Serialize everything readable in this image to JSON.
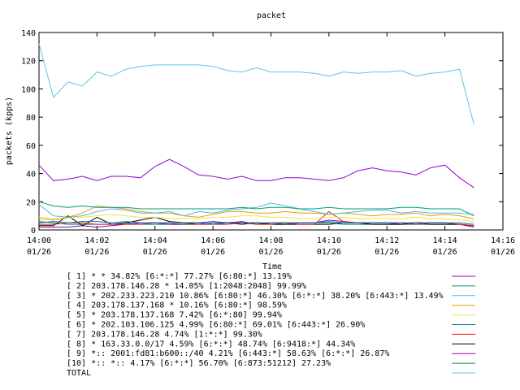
{
  "chart_data": {
    "type": "line",
    "title": "packet",
    "xlabel": "Time",
    "ylabel": "packets (kpps)",
    "ylim": [
      0,
      140
    ],
    "yticks": [
      0,
      20,
      40,
      60,
      80,
      100,
      120,
      140
    ],
    "xlim": [
      "14:00",
      "14:16"
    ],
    "xticks": [
      {
        "time": "14:00",
        "date": "01/26"
      },
      {
        "time": "14:02",
        "date": "01/26"
      },
      {
        "time": "14:04",
        "date": "01/26"
      },
      {
        "time": "14:06",
        "date": "01/26"
      },
      {
        "time": "14:08",
        "date": "01/26"
      },
      {
        "time": "14:10",
        "date": "01/26"
      },
      {
        "time": "14:12",
        "date": "01/26"
      },
      {
        "time": "14:14",
        "date": "01/26"
      },
      {
        "time": "14:16",
        "date": "01/26"
      }
    ],
    "x": [
      "14:00",
      "14:00:30",
      "14:01",
      "14:01:30",
      "14:02",
      "14:02:30",
      "14:03",
      "14:03:30",
      "14:04",
      "14:04:30",
      "14:05",
      "14:05:30",
      "14:06",
      "14:06:30",
      "14:07",
      "14:07:30",
      "14:08",
      "14:08:30",
      "14:09",
      "14:09:30",
      "14:10",
      "14:10:30",
      "14:11",
      "14:11:30",
      "14:12",
      "14:12:30",
      "14:13",
      "14:13:30",
      "14:14",
      "14:14:30",
      "14:15"
    ],
    "legend_placement": "bottom",
    "series": [
      {
        "name": "[ 1] * * 34.82%  [6:*:*] 77.27% [6:80:*] 13.19%",
        "color": "#9400d3",
        "values": [
          46,
          35,
          36,
          38,
          35,
          38,
          38,
          37,
          45,
          50,
          45,
          39,
          38,
          36,
          38,
          35,
          35,
          37,
          37,
          36,
          35,
          37,
          42,
          44,
          42,
          41,
          39,
          44,
          46,
          37,
          30
        ]
      },
      {
        "name": "[ 2] 203.178.146.28 * 14.05%  [1:2048:2048] 99.99%",
        "color": "#009e73",
        "values": [
          20,
          17,
          16,
          17,
          16,
          16,
          16,
          15,
          15,
          15,
          15,
          15,
          15,
          15,
          16,
          15,
          16,
          16,
          15,
          15,
          16,
          15,
          15,
          15,
          15,
          16,
          16,
          15,
          15,
          15,
          10
        ]
      },
      {
        "name": "[ 3] * 202.233.223.210 10.86%  [6:80:*] 46.30% [6:*:*] 38.20% [6:443:*] 13.49%",
        "color": "#56b4e9",
        "values": [
          18,
          10,
          9,
          10,
          13,
          15,
          14,
          12,
          12,
          13,
          10,
          13,
          12,
          14,
          15,
          16,
          19,
          17,
          15,
          13,
          11,
          12,
          13,
          14,
          14,
          12,
          13,
          12,
          12,
          12,
          11
        ]
      },
      {
        "name": "[ 4] 203.178.137.168 * 10.16%  [6:80:*] 98.59%",
        "color": "#e69f00",
        "values": [
          8,
          7,
          9,
          12,
          17,
          16,
          15,
          13,
          12,
          12,
          10,
          9,
          11,
          13,
          13,
          12,
          12,
          13,
          12,
          12,
          11,
          12,
          11,
          10,
          11,
          11,
          12,
          10,
          11,
          10,
          8
        ]
      },
      {
        "name": "[ 5] * 203.178.137.168 7.42%  [6:*:80] 99.94%",
        "color": "#f0e442",
        "values": [
          9,
          8,
          8,
          9,
          10,
          11,
          10,
          9,
          9,
          8,
          8,
          8,
          9,
          9,
          10,
          10,
          9,
          9,
          8,
          8,
          9,
          9,
          8,
          8,
          8,
          8,
          9,
          8,
          8,
          7,
          6
        ]
      },
      {
        "name": "[ 6] * 202.103.106.125 4.99%  [6:80:*] 69.01% [6:443:*] 26.90%",
        "color": "#0072b2",
        "values": [
          5,
          6,
          5,
          6,
          6,
          5,
          6,
          5,
          5,
          5,
          4,
          5,
          4,
          5,
          5,
          5,
          5,
          5,
          5,
          5,
          6,
          5,
          5,
          5,
          5,
          5,
          5,
          5,
          5,
          5,
          4
        ]
      },
      {
        "name": "[ 7] 203.178.146.28 4.74%  [1:*:*] 99.30%",
        "color": "#e51e10",
        "values": [
          4,
          4,
          5,
          5,
          4,
          4,
          4,
          4,
          5,
          5,
          4,
          4,
          4,
          4,
          5,
          4,
          4,
          5,
          4,
          4,
          13,
          6,
          5,
          5,
          5,
          5,
          4,
          5,
          5,
          4,
          3
        ]
      },
      {
        "name": "[ 8] * 163.33.0.0/17 4.59%  [6:*:*] 48.74% [6:9418:*] 44.34%",
        "color": "#000000",
        "values": [
          3,
          3,
          10,
          3,
          9,
          4,
          5,
          7,
          9,
          6,
          5,
          5,
          4,
          5,
          4,
          5,
          4,
          4,
          4,
          4,
          4,
          5,
          5,
          4,
          4,
          4,
          5,
          4,
          4,
          4,
          3
        ]
      },
      {
        "name": "[ 9] *:: 2001:fd81:b600::/40 4.21%  [6:443:*] 58.63% [6:*:*] 26.87%",
        "color": "#8b00c8",
        "values": [
          2,
          2,
          2,
          3,
          2,
          3,
          4,
          5,
          5,
          4,
          4,
          5,
          6,
          5,
          6,
          4,
          5,
          5,
          5,
          5,
          7,
          6,
          5,
          5,
          5,
          4,
          5,
          5,
          5,
          4,
          2
        ]
      },
      {
        "name": "[10] *:: *:: 4.17%  [6:*:*] 56.70% [6:873:51212] 27.23%",
        "color": "#008a5a",
        "values": [
          6,
          5,
          4,
          4,
          4,
          4,
          5,
          4,
          4,
          4,
          4,
          4,
          5,
          5,
          5,
          5,
          4,
          4,
          5,
          5,
          5,
          4,
          4,
          4,
          4,
          4,
          4,
          4,
          4,
          4,
          3
        ]
      },
      {
        "name": "TOTAL",
        "color": "#5ec4e8",
        "values": [
          132,
          94,
          105,
          102,
          112,
          109,
          114,
          116,
          117,
          117,
          117,
          117,
          116,
          113,
          112,
          115,
          112,
          112,
          112,
          111,
          109,
          112,
          111,
          112,
          112,
          113,
          109,
          111,
          112,
          114,
          75
        ]
      }
    ]
  }
}
